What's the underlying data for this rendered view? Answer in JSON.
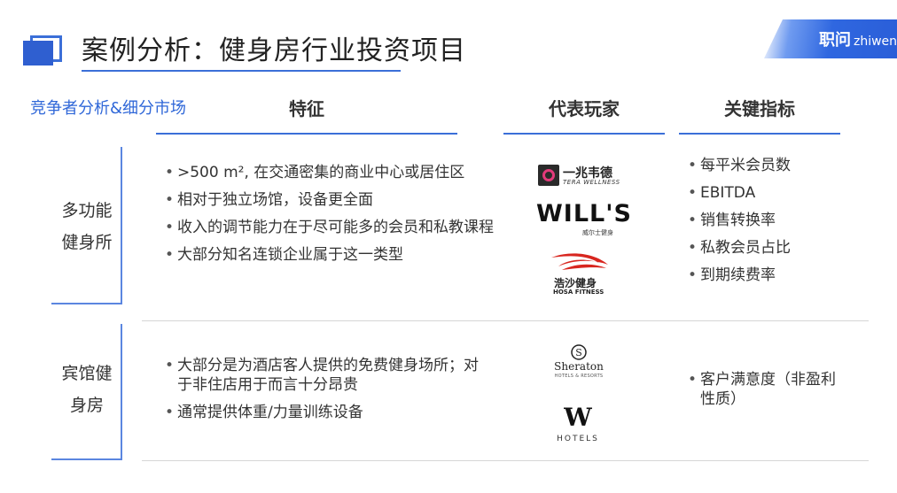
{
  "header": {
    "title": "案例分析：健身房行业投资项目",
    "brand_cn": "职问",
    "brand_en": "zhiwen"
  },
  "table": {
    "section_label": "竞争者分析&细分市场",
    "columns": [
      "特征",
      "代表玩家",
      "关键指标"
    ],
    "rows": [
      {
        "label_line1": "多功能",
        "label_line2": "健身所",
        "features": [
          ">500 m², 在交通密集的商业中心或居住区",
          "相对于独立场馆，设备更全面",
          "收入的调节能力在于尽可能多的会员和私教课程",
          "大部分知名连锁企业属于这一类型"
        ],
        "kpis": [
          "每平米会员数",
          "EBITDA",
          "销售转换率",
          "私教会员占比",
          "到期续费率"
        ]
      },
      {
        "label_line1": "宾馆健",
        "label_line2": "身房",
        "features": [
          "大部分是为酒店客人提供的免费健身场所；对于非住店用于而言十分昂贵",
          "通常提供体重/力量训练设备"
        ],
        "kpis": [
          "客户满意度（非盈利性质）"
        ]
      }
    ]
  },
  "logos": {
    "tera": {
      "cn": "一兆韦德",
      "en": "TERA WELLNESS"
    },
    "wills": {
      "en": "WILL'S",
      "cn": "威尔士健身"
    },
    "hosa": {
      "cn": "浩沙健身",
      "en": "HOSA FITNESS"
    },
    "sheraton": {
      "en": "Sheraton",
      "sub": "HOTELS & RESORTS"
    },
    "whotels": {
      "mark": "W",
      "en": "HOTELS"
    }
  },
  "colors": {
    "accent": "#2f67d8",
    "title": "#222222",
    "divider": "#d6d6d6",
    "hosa_red": "#d8261f"
  }
}
